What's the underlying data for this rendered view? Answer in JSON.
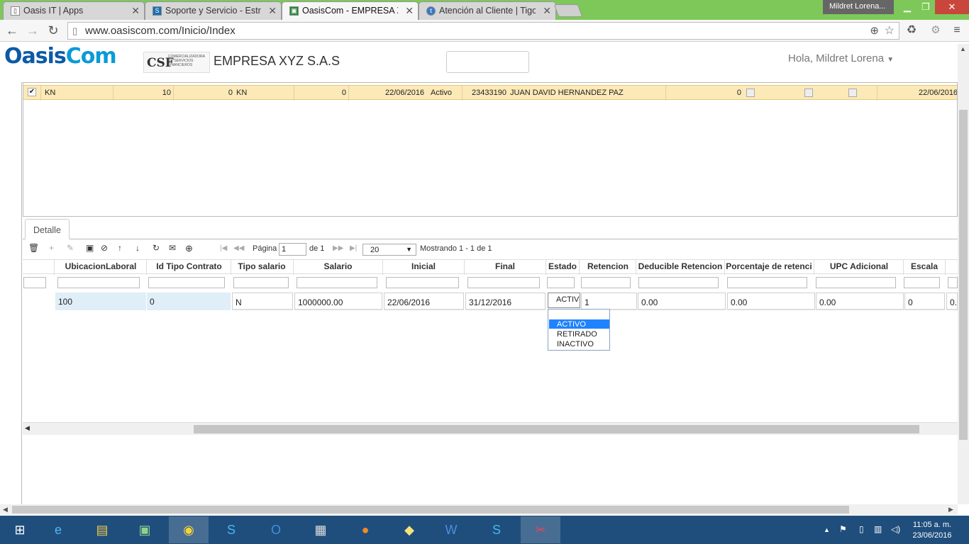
{
  "browser": {
    "tabs": [
      {
        "title": "Oasis IT | Apps",
        "icon": "doc-icon"
      },
      {
        "title": "Soporte y Servicio - Estruc",
        "icon": "sharepoint-icon"
      },
      {
        "title": "OasisCom - EMPRESA XYZ",
        "icon": "oasiscom-icon",
        "active": true
      },
      {
        "title": "Atención al Cliente | Tigo",
        "icon": "tigo-icon"
      }
    ],
    "window_user": "Mildret Lorena...",
    "url": "www.oasiscom.com/Inicio/Index"
  },
  "header": {
    "logo_a": "Oasis",
    "logo_b": "Com",
    "csf_mark": "CSF",
    "csf_sub": "COMERCIALIZADORA DE SERVICIOS FINANCIEROS",
    "company": "EMPRESA XYZ S.A.S",
    "greeting": "Hola, Mildret Lorena"
  },
  "upper_row": {
    "c1": "KN",
    "c2": "10",
    "c3": "0",
    "c4": "KN",
    "c5": "0",
    "c6": "22/06/2016",
    "c7": "Activo",
    "c8": "23433190",
    "c9": "JUAN DAVID HERNANDEZ PAZ",
    "c10": "0",
    "c11": "22/06/2016"
  },
  "detail": {
    "tab": "Detalle",
    "pager": {
      "page_label": "Página",
      "page_value": "1",
      "of_label": "de 1",
      "page_size": "20",
      "showing": "Mostrando 1 - 1 de 1"
    },
    "columns": {
      "ubicacion": "UbicacionLaboral",
      "tipo_contrato": "Id Tipo Contrato",
      "tipo_salario": "Tipo salario",
      "salario": "Salario",
      "inicial": "Inicial",
      "final": "Final",
      "estado": "Estado",
      "retencion": "Retencion",
      "deducible": "Deducible Retencion",
      "porcentaje": "Porcentaje de retenci",
      "upc": "UPC Adicional",
      "escala": "Escala"
    },
    "row": {
      "ubicacion": "100",
      "tipo_contrato": "0",
      "tipo_salario": "N",
      "salario": "1000000.00",
      "inicial": "22/06/2016",
      "final": "31/12/2016",
      "estado": "ACTIV",
      "retencion": "1",
      "deducible": "0.00",
      "porcentaje": "0.00",
      "upc": "0.00",
      "escala": "0",
      "extra": "0."
    },
    "estado_options": [
      "ACTIVO",
      "RETIRADO",
      "INACTIVO"
    ],
    "estado_selected": "ACTIVO"
  },
  "taskbar": {
    "time": "11:05 a. m.",
    "date": "23/06/2016"
  },
  "colors": {
    "tabbar": "#7ec85a",
    "selected_row": "#fbe9b8",
    "dropdown_sel": "#1f82ff",
    "taskbar": "#1f4e7c"
  }
}
